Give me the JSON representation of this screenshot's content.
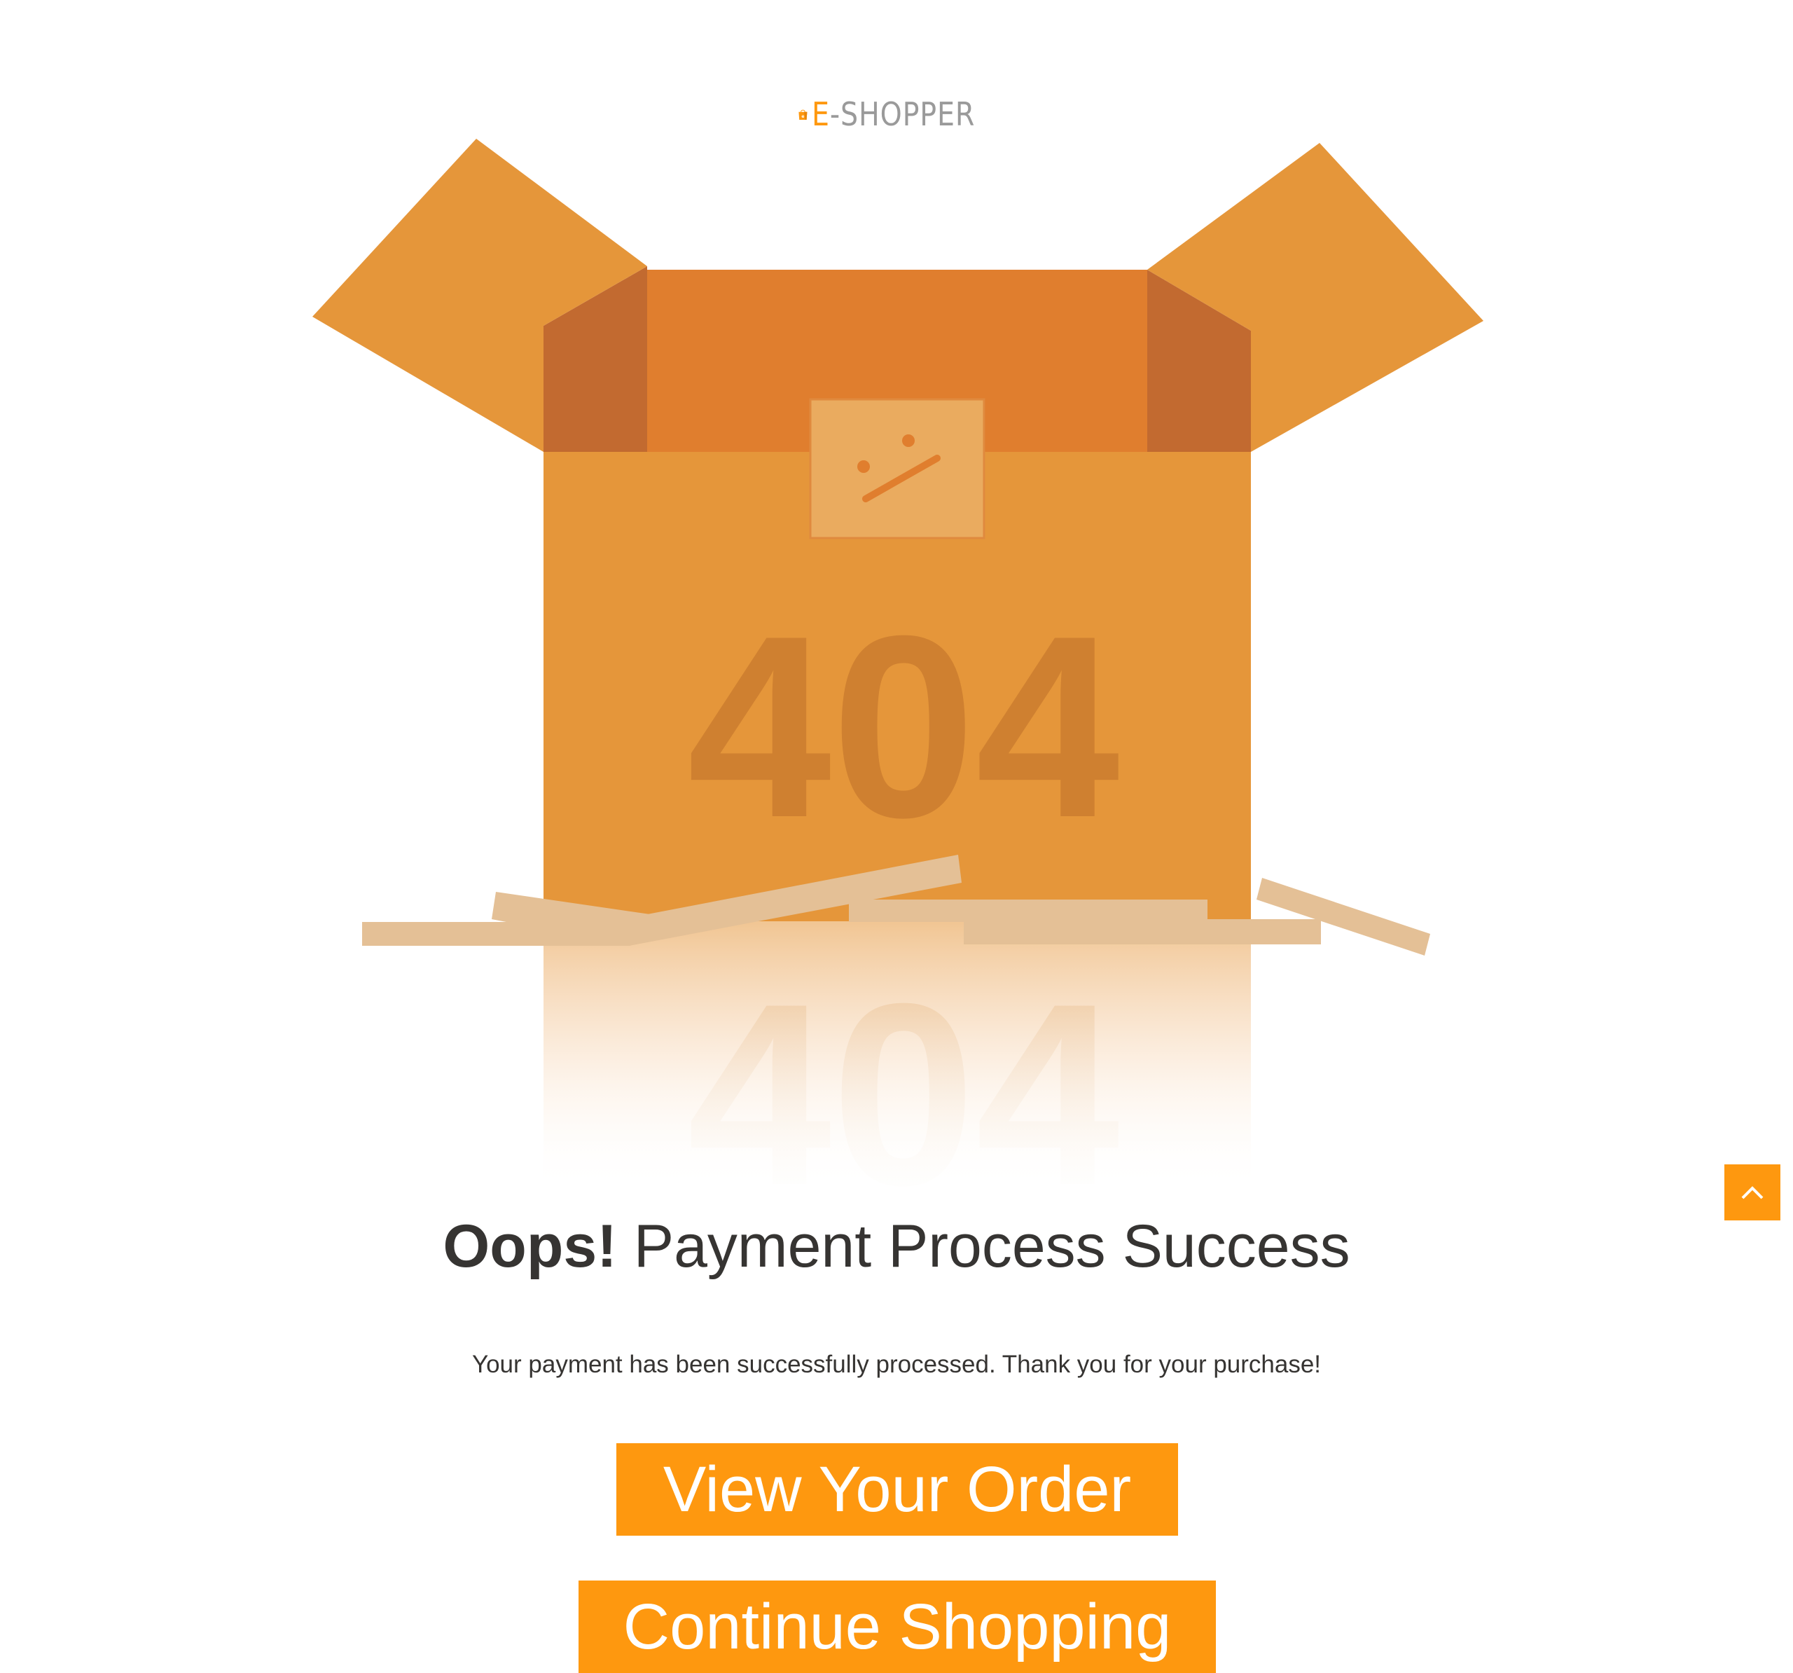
{
  "brand": {
    "name_accent": "E",
    "name_rest": "-SHOPPER",
    "logo_icon": "shopping-bag-icon",
    "bag_letter": "e"
  },
  "illustration": {
    "code": "404",
    "icon": "open-box-illustration"
  },
  "headline": {
    "emphasis": "Oops!",
    "text": " Payment Process Success"
  },
  "message": "Your payment has been successfully processed. Thank you for your purchase!",
  "buttons": {
    "view_order": "View Your Order",
    "continue_shopping": "Continue Shopping"
  },
  "scroll_top": {
    "icon": "chevron-up-icon"
  },
  "colors": {
    "accent": "#fe980f",
    "box": "#e5963a",
    "box_dark": "#c26a30",
    "box_inside": "#e07e2e",
    "text": "#363432"
  }
}
